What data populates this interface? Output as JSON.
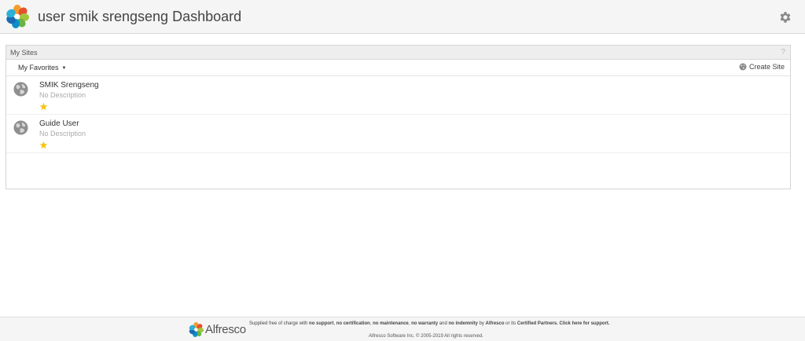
{
  "header": {
    "title": "user smik srengseng Dashboard",
    "logo_icon": "alfresco-flower-logo",
    "settings_icon": "gear-icon"
  },
  "my_sites": {
    "title": "My Sites",
    "help_label": "?",
    "filter_label": "My Favorites",
    "create_site_label": "Create Site",
    "sites": [
      {
        "name": "SMIK Srengseng",
        "description": "No Description",
        "favorite": true
      },
      {
        "name": "Guide User",
        "description": "No Description",
        "favorite": true
      }
    ]
  },
  "footer": {
    "brand": "Alfresco",
    "supplied_prefix": "Supplied free of charge with ",
    "no_support": "no support",
    "sep1": ", ",
    "no_certification": "no certification",
    "sep2": ", ",
    "no_maintenance": "no maintenance",
    "sep3": ", ",
    "no_warranty": "no warranty",
    "and": " and ",
    "no_indemnity": "no indemnity",
    "by": " by ",
    "alfresco": "Alfresco",
    "or_its": " or its ",
    "certified_partners": "Certified Partners",
    "click_here": ". Click here for support.",
    "copyright": "Alfresco Software Inc. © 2005-2019 All rights reserved."
  },
  "colors": {
    "star": "#f5c518",
    "header_bg": "#f5f5f5"
  }
}
